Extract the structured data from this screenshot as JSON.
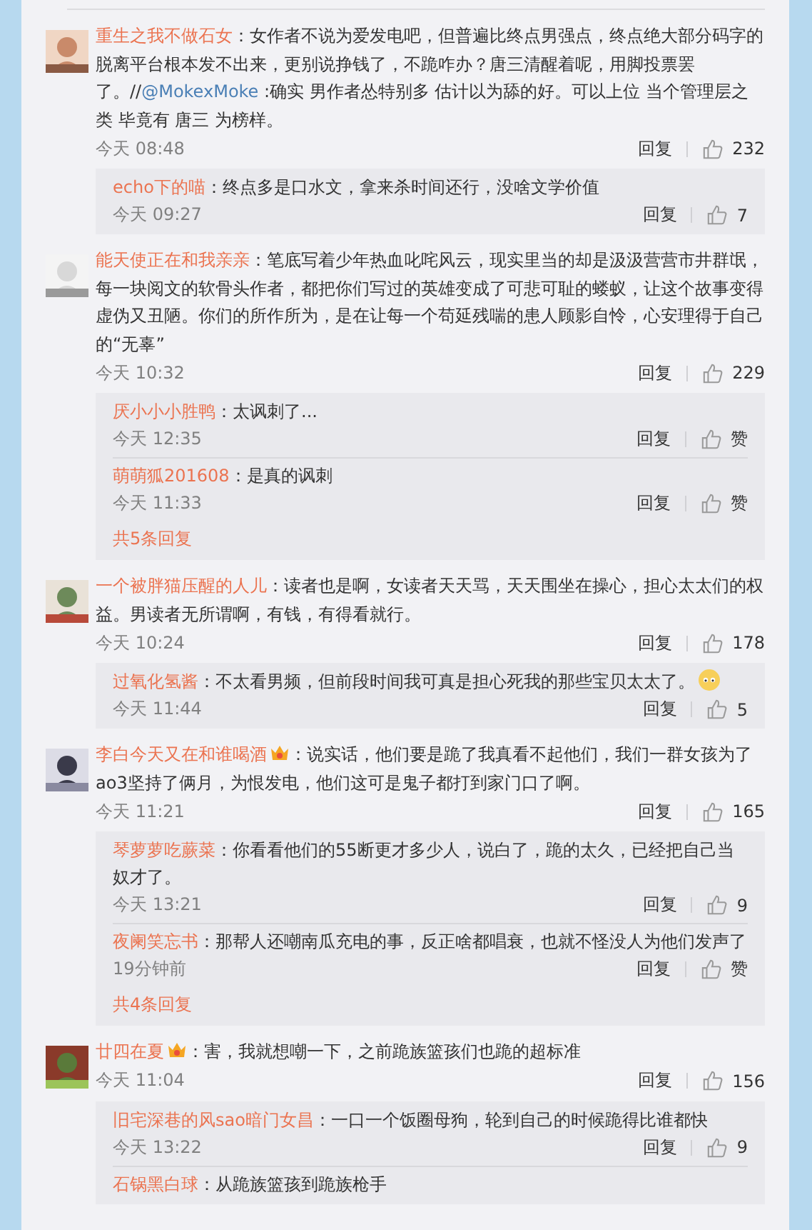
{
  "comments": [
    {
      "author": "重生之我不做石女",
      "vip": false,
      "text": [
        {
          "kind": "plain",
          "text": "：女作者不说为爱发电吧，但普遍比终点男强点，终点绝大部分码字的脱离平台根本发不出来，更别说挣钱了，不跪咋办？唐三清醒着呢，用脚投票罢了。//"
        },
        {
          "kind": "mention",
          "text": "@MokexMoke"
        },
        {
          "kind": "plain",
          "text": " :确实 男作者怂特别多 估计以为舔的好。可以上位 当个管理层之类 毕竟有 唐三 为榜样。"
        }
      ],
      "time": "今天 08:48",
      "reply_label": "回复",
      "likes": "232",
      "replies": [
        {
          "author": "echo下的喵",
          "text": "：终点多是口水文，拿来杀时间还行，没啥文学价值",
          "emoji": false,
          "time": "今天 09:27",
          "reply_label": "回复",
          "likes": "7"
        }
      ]
    },
    {
      "author": "能天使正在和我亲亲",
      "vip": false,
      "text": [
        {
          "kind": "plain",
          "text": "：笔底写着少年热血叱咤风云，现实里当的却是汲汲营营市井群氓，每一块阅文的软骨头作者，都把你们写过的英雄变成了可悲可耻的蝼蚁，让这个故事变得虚伪又丑陋。你们的所作所为，是在让每一个苟延残喘的患人顾影自怜，心安理得于自己的“无辜”"
        }
      ],
      "time": "今天 10:32",
      "reply_label": "回复",
      "likes": "229",
      "replies": [
        {
          "author": "厌小小小胜鸭",
          "text": "：太讽刺了...",
          "emoji": false,
          "time": "今天 12:35",
          "reply_label": "回复",
          "likes": "赞"
        },
        {
          "author": "萌萌狐201608",
          "text": "：是真的讽刺",
          "emoji": false,
          "time": "今天 11:33",
          "reply_label": "回复",
          "likes": "赞"
        }
      ],
      "more": "共5条回复"
    },
    {
      "author": "一个被胖猫压醒的人儿",
      "vip": false,
      "text": [
        {
          "kind": "plain",
          "text": "：读者也是啊，女读者天天骂，天天围坐在操心，担心太太们的权益。男读者无所谓啊，有钱，有得看就行。"
        }
      ],
      "time": "今天 10:24",
      "reply_label": "回复",
      "likes": "178",
      "replies": [
        {
          "author": "过氧化氢酱",
          "text": "：不太看男频，但前段时间我可真是担心死我的那些宝贝太太了。",
          "emoji": true,
          "time": "今天 11:44",
          "reply_label": "回复",
          "likes": "5"
        }
      ]
    },
    {
      "author": "李白今天又在和谁喝酒",
      "vip": true,
      "text": [
        {
          "kind": "plain",
          "text": "：说实话，他们要是跪了我真看不起他们，我们一群女孩为了ao3坚持了俩月，为恨发电，他们这可是鬼子都打到家门口了啊。"
        }
      ],
      "time": "今天 11:21",
      "reply_label": "回复",
      "likes": "165",
      "replies": [
        {
          "author": "琴萝萝吃蕨菜",
          "text": "：你看看他们的55断更才多少人，说白了，跪的太久，已经把自己当奴才了。",
          "emoji": false,
          "time": "今天 13:21",
          "reply_label": "回复",
          "likes": "9"
        },
        {
          "author": "夜阑笑忘书",
          "text": "：那帮人还嘲南瓜充电的事，反正啥都唱衰，也就不怪没人为他们发声了",
          "emoji": false,
          "time": "19分钟前",
          "reply_label": "回复",
          "likes": "赞"
        }
      ],
      "more": "共4条回复"
    },
    {
      "author": "廿四在夏",
      "vip": true,
      "text": [
        {
          "kind": "plain",
          "text": "：害，我就想嘲一下，之前跪族篮孩们也跪的超标准"
        }
      ],
      "time": "今天 11:04",
      "reply_label": "回复",
      "likes": "156",
      "replies": [
        {
          "author": "旧宅深巷的风sao暗门女昌",
          "text": "：一口一个饭圈母狗，轮到自己的时候跪得比谁都快",
          "emoji": false,
          "time": "今天 13:22",
          "reply_label": "回复",
          "likes": "9"
        },
        {
          "author": "石锅黑白球",
          "text": "：从跪族篮孩到跪族枪手",
          "emoji": false
        }
      ]
    }
  ]
}
